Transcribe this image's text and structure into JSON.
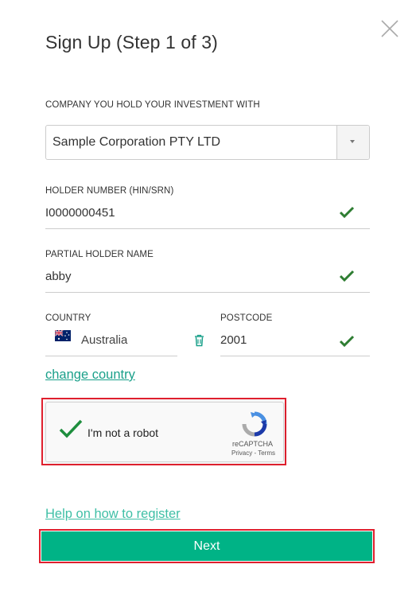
{
  "dialog": {
    "title": "Sign Up (Step 1 of 3)",
    "close_icon": "close-icon"
  },
  "company": {
    "label": "COMPANY YOU HOLD YOUR INVESTMENT WITH",
    "value": "Sample Corporation PTY LTD",
    "dropdown_icon": "chevron-down-icon"
  },
  "holder_number": {
    "label": "HOLDER NUMBER (HIN/SRN)",
    "value": "I0000000451",
    "status_icon": "checkmark-icon"
  },
  "partial_holder_name": {
    "label": "PARTIAL HOLDER NAME",
    "value": "abby",
    "status_icon": "checkmark-icon"
  },
  "country": {
    "label": "COUNTRY",
    "value": "Australia",
    "flag_icon": "australia-flag-icon",
    "delete_icon": "trash-icon"
  },
  "postcode": {
    "label": "POSTCODE",
    "value": "2001",
    "status_icon": "checkmark-icon"
  },
  "change_country_link": "change country",
  "recaptcha": {
    "label": "I'm not a robot",
    "brand": "reCAPTCHA",
    "privacy": "Privacy",
    "separator": " - ",
    "terms": "Terms",
    "checked": true
  },
  "help_link": "Help on how to register",
  "next_button": "Next",
  "colors": {
    "accent": "#00b386",
    "link": "#1aa08a",
    "check": "#2e7d32",
    "highlight": "#e0202e"
  }
}
